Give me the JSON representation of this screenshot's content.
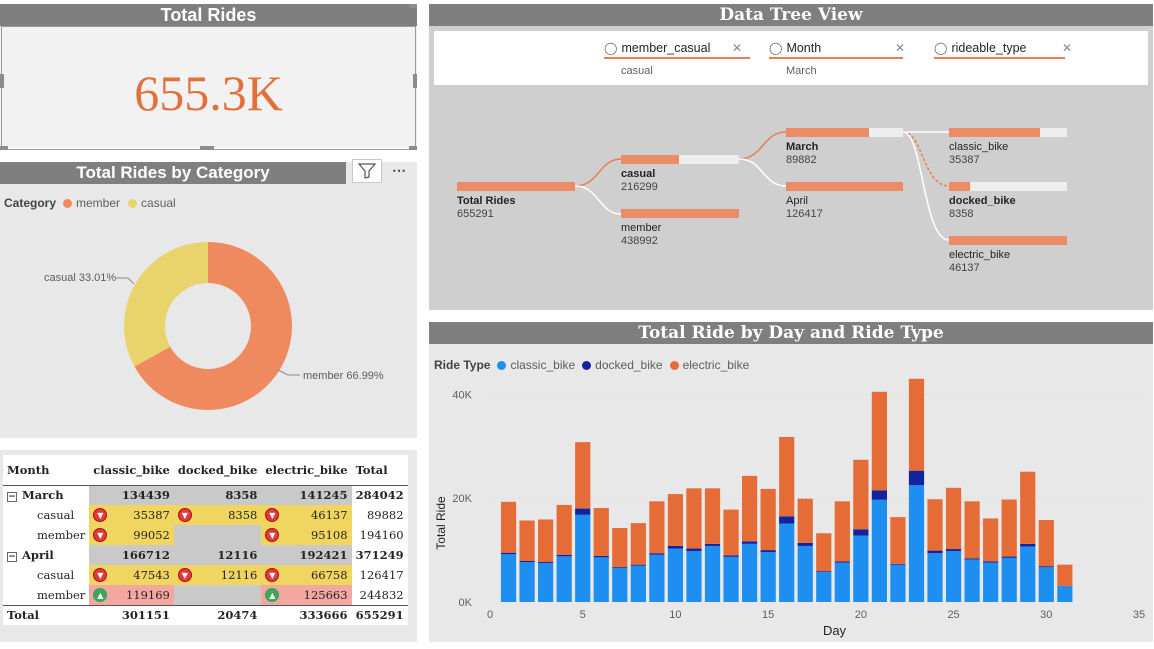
{
  "kpi": {
    "title": "Total Rides",
    "value": "655.3K"
  },
  "donut": {
    "title": "Total Rides by Category",
    "legend_title": "Category",
    "colors": {
      "member": "#ee8a5e",
      "casual": "#e9d36b"
    },
    "labels": {
      "casual": "casual 33.01%",
      "member": "member 66.99%"
    },
    "legend": [
      "member",
      "casual"
    ]
  },
  "matrix": {
    "headers": [
      "Month",
      "classic_bike",
      "docked_bike",
      "electric_bike",
      "Total"
    ],
    "rows": [
      {
        "label": "March",
        "level": 0,
        "expander": "⊟",
        "vals": [
          "134439",
          "8358",
          "141245",
          "284042"
        ],
        "styles": [
          "g",
          "g",
          "g",
          ""
        ],
        "icons": [
          "",
          "",
          "",
          ""
        ]
      },
      {
        "label": "casual",
        "level": 1,
        "vals": [
          "35387",
          "8358",
          "46137",
          "89882"
        ],
        "styles": [
          "y",
          "y",
          "y",
          ""
        ],
        "icons": [
          "down",
          "down",
          "down",
          ""
        ]
      },
      {
        "label": "member",
        "level": 1,
        "vals": [
          "99052",
          "",
          "95108",
          "194160"
        ],
        "styles": [
          "y",
          "g",
          "y",
          ""
        ],
        "icons": [
          "down",
          "",
          "down",
          ""
        ]
      },
      {
        "label": "April",
        "level": 0,
        "expander": "⊟",
        "vals": [
          "166712",
          "12116",
          "192421",
          "371249"
        ],
        "styles": [
          "g",
          "g",
          "g",
          ""
        ],
        "icons": [
          "",
          "",
          "",
          ""
        ]
      },
      {
        "label": "casual",
        "level": 1,
        "vals": [
          "47543",
          "12116",
          "66758",
          "126417"
        ],
        "styles": [
          "y",
          "y",
          "y",
          ""
        ],
        "icons": [
          "down",
          "down",
          "down",
          ""
        ]
      },
      {
        "label": "member",
        "level": 1,
        "vals": [
          "119169",
          "",
          "125663",
          "244832"
        ],
        "styles": [
          "p",
          "g",
          "p",
          ""
        ],
        "icons": [
          "up",
          "",
          "up",
          ""
        ]
      }
    ],
    "total": {
      "label": "Total",
      "vals": [
        "301151",
        "20474",
        "333666",
        "655291"
      ]
    }
  },
  "tree": {
    "title": "Data Tree View",
    "filters": [
      {
        "field": "member_casual",
        "value": "casual"
      },
      {
        "field": "Month",
        "value": "March"
      },
      {
        "field": "rideable_type",
        "value": ""
      }
    ],
    "nodes": {
      "root": {
        "name": "Total Rides",
        "value": "655291",
        "fill": 1.0
      },
      "casual": {
        "name": "casual",
        "value": "216299",
        "fill": 0.493
      },
      "member": {
        "name": "member",
        "value": "438992",
        "fill": 1.0
      },
      "march": {
        "name": "March",
        "value": "89882",
        "fill": 0.711
      },
      "april": {
        "name": "April",
        "value": "126417",
        "fill": 1.0
      },
      "classic": {
        "name": "classic_bike",
        "value": "35387",
        "fill": 0.767
      },
      "docked": {
        "name": "docked_bike",
        "value": "8358",
        "fill": 0.181
      },
      "electric": {
        "name": "electric_bike",
        "value": "46137",
        "fill": 1.0
      }
    }
  },
  "stack": {
    "title": "Total Ride by Day and Ride Type",
    "legend_title": "Ride Type",
    "series_names": [
      "classic_bike",
      "docked_bike",
      "electric_bike"
    ],
    "colors": {
      "classic_bike": "#1e8ff0",
      "docked_bike": "#12239e",
      "electric_bike": "#e66c37"
    }
  },
  "chart_data": {
    "type": "bar",
    "stacked": true,
    "title": "Total Ride by Day and Ride Type",
    "xlabel": "Day",
    "ylabel": "Total Ride",
    "xlim": [
      0,
      35
    ],
    "ylim": [
      0,
      42000
    ],
    "xticks": [
      "0",
      "5",
      "10",
      "15",
      "20",
      "25",
      "30",
      "35"
    ],
    "yticks": [
      "0K",
      "20K",
      "40K"
    ],
    "legend_title": "Ride Type",
    "legend_position": "top-left",
    "x": [
      1,
      2,
      3,
      4,
      5,
      6,
      7,
      8,
      9,
      10,
      11,
      12,
      13,
      14,
      15,
      16,
      17,
      18,
      19,
      20,
      21,
      22,
      23,
      24,
      25,
      26,
      27,
      28,
      29,
      30,
      31
    ],
    "series": [
      {
        "name": "classic_bike",
        "values": [
          9200,
          7700,
          7500,
          8800,
          16800,
          8600,
          6600,
          7000,
          9100,
          10300,
          9800,
          10800,
          8700,
          11200,
          9600,
          15100,
          10800,
          5800,
          7600,
          12800,
          19700,
          7200,
          22500,
          9400,
          9800,
          8200,
          7600,
          8500,
          10700,
          6700,
          3100
        ]
      },
      {
        "name": "docked_bike",
        "values": [
          300,
          200,
          200,
          300,
          1200,
          300,
          150,
          200,
          300,
          500,
          500,
          400,
          300,
          500,
          400,
          1400,
          600,
          150,
          200,
          1200,
          1800,
          150,
          2800,
          500,
          400,
          200,
          200,
          250,
          500,
          200,
          0
        ]
      },
      {
        "name": "electric_bike",
        "values": [
          9800,
          7800,
          8200,
          9600,
          12800,
          9200,
          7500,
          8000,
          10000,
          10000,
          11600,
          10700,
          8800,
          12600,
          11800,
          15300,
          8500,
          7300,
          11600,
          13400,
          19000,
          9000,
          17700,
          9900,
          11800,
          11000,
          8300,
          11000,
          13900,
          8900,
          4100
        ]
      }
    ]
  }
}
